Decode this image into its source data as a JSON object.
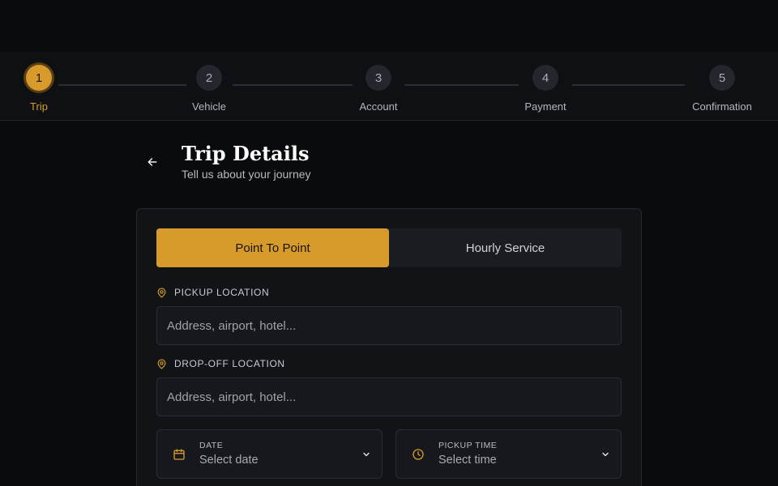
{
  "stepper": {
    "steps": [
      {
        "number": "1",
        "label": "Trip",
        "state": "active"
      },
      {
        "number": "2",
        "label": "Vehicle",
        "state": "pending"
      },
      {
        "number": "3",
        "label": "Account",
        "state": "pending"
      },
      {
        "number": "4",
        "label": "Payment",
        "state": "pending"
      },
      {
        "number": "5",
        "label": "Confirmation",
        "state": "pending"
      }
    ]
  },
  "header": {
    "back_icon": "arrow-left-icon",
    "title": "Trip Details",
    "subtitle": "Tell us about your journey"
  },
  "form": {
    "tabs": [
      {
        "label": "Point To Point",
        "selected": true
      },
      {
        "label": "Hourly Service",
        "selected": false
      }
    ],
    "pickup": {
      "label": "PICKUP LOCATION",
      "icon": "map-pin-icon",
      "placeholder": "Address, airport, hotel..."
    },
    "dropoff": {
      "label": "DROP-OFF LOCATION",
      "icon": "map-pin-icon",
      "placeholder": "Address, airport, hotel..."
    },
    "date": {
      "caption": "DATE",
      "value": "Select date",
      "icon": "calendar-icon"
    },
    "time": {
      "caption": "PICKUP TIME",
      "value": "Select time",
      "icon": "clock-icon"
    }
  },
  "colors": {
    "accent": "#d79b2c",
    "background": "#0a0b0d",
    "card": "#121317"
  }
}
